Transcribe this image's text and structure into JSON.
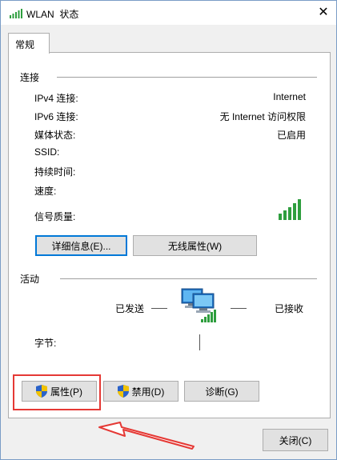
{
  "window": {
    "title": "WLAN  状态",
    "close_glyph": "✕"
  },
  "tab": {
    "label": "常规"
  },
  "connection": {
    "heading": "连接",
    "rows": [
      {
        "label": "IPv4 连接:",
        "value": "Internet"
      },
      {
        "label": "IPv6 连接:",
        "value": "无 Internet 访问权限"
      },
      {
        "label": "媒体状态:",
        "value": "已启用"
      },
      {
        "label": "SSID:",
        "value": ""
      },
      {
        "label": "持续时间:",
        "value": ""
      },
      {
        "label": "速度:",
        "value": ""
      }
    ],
    "signal_label": "信号质量:",
    "signal_bars": 5,
    "details_button": "详细信息(E)...",
    "wireless_button": "无线属性(W)"
  },
  "activity": {
    "heading": "活动",
    "sent_label": "已发送",
    "received_label": "已接收",
    "bytes_label": "字节:"
  },
  "buttons": {
    "properties": "属性(P)",
    "disable": "禁用(D)",
    "diagnose": "诊断(G)",
    "close": "关闭(C)"
  },
  "colors": {
    "signal_green": "#2e9e3e",
    "annotation_red": "#e53935",
    "focus_blue": "#0078d7"
  }
}
